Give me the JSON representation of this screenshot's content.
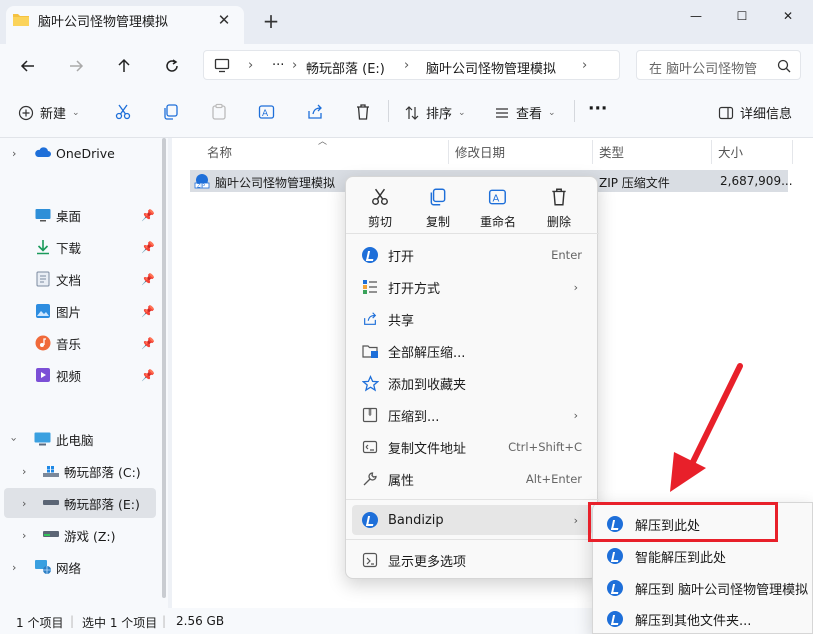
{
  "tab": {
    "title": "脑叶公司怪物管理模拟",
    "close": "✕",
    "new": "+"
  },
  "window_controls": {
    "minimize": "—",
    "maximize": "☐",
    "close": "✕"
  },
  "address": {
    "more": "···",
    "crumbs": [
      "畅玩部落 (E:)",
      "脑叶公司怪物管理模拟"
    ],
    "search_placeholder": "在 脑叶公司怪物管"
  },
  "toolbar": {
    "new_label": "新建",
    "sort_label": "排序",
    "view_label": "查看",
    "more_label": "···",
    "details_label": "详细信息"
  },
  "sidebar": {
    "onedrive": "OneDrive",
    "quick": [
      "桌面",
      "下载",
      "文档",
      "图片",
      "音乐",
      "视频"
    ],
    "this_pc": "此电脑",
    "drives": [
      "畅玩部落 (C:)",
      "畅玩部落 (E:)",
      "游戏 (Z:)"
    ],
    "network": "网络"
  },
  "columns": {
    "name": "名称",
    "modified": "修改日期",
    "type": "类型",
    "size": "大小"
  },
  "file": {
    "name": "脑叶公司怪物管理模拟",
    "type": "ZIP 压缩文件",
    "size": "2,687,909..."
  },
  "context_menu": {
    "quick_actions": [
      "剪切",
      "复制",
      "重命名",
      "删除"
    ],
    "items": [
      {
        "label": "打开",
        "shortcut": "Enter"
      },
      {
        "label": "打开方式",
        "shortcut": ""
      },
      {
        "label": "共享",
        "shortcut": ""
      },
      {
        "label": "全部解压缩...",
        "shortcut": ""
      },
      {
        "label": "添加到收藏夹",
        "shortcut": ""
      },
      {
        "label": "压缩到...",
        "shortcut": ""
      },
      {
        "label": "复制文件地址",
        "shortcut": "Ctrl+Shift+C"
      },
      {
        "label": "属性",
        "shortcut": "Alt+Enter"
      },
      {
        "label": "Bandizip",
        "shortcut": ""
      },
      {
        "label": "显示更多选项",
        "shortcut": ""
      }
    ]
  },
  "submenu": {
    "items": [
      "解压到此处",
      "智能解压到此处",
      "解压到 脑叶公司怪物管理模拟",
      "解压到其他文件夹..."
    ]
  },
  "status": {
    "count": "1 个项目",
    "selected": "选中 1 个项目",
    "size": "2.56 GB"
  },
  "colors": {
    "accent": "#1e6fd9",
    "annotation_red": "#e8202a",
    "selection": "#d9dde3"
  }
}
